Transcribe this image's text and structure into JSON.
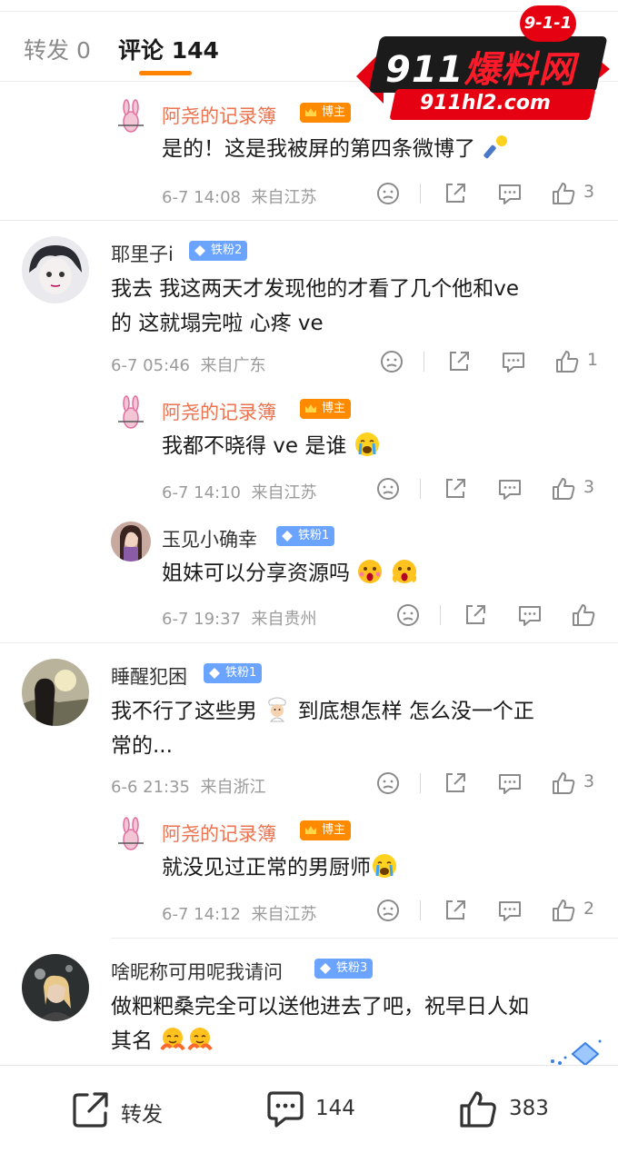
{
  "tabs": {
    "repost_label": "转发 0",
    "comments_label": "评论 144",
    "likes_partial": "3"
  },
  "watermark": {
    "badge": "9-1-1",
    "title_num": "911",
    "title_cn": "爆料网",
    "url": "911hl2.com"
  },
  "comments": [
    {
      "name": "阿尧的记录簿",
      "badge": "博主",
      "text": [
        "是的！这是我被屏的第四条微博了"
      ],
      "time": "6-7 14:08",
      "loc": "来自江苏",
      "likes": "3"
    },
    {
      "name": "耶里子i",
      "badge": "铁粉2",
      "text": [
        "我去 我这两天才发现他的才看了几个他和ve",
        "的  这就塌完啦    心疼 ve"
      ],
      "time": "6-7 05:46",
      "loc": "来自广东",
      "likes": "1"
    },
    {
      "name": "阿尧的记录簿",
      "badge": "博主",
      "text": [
        "我都不晓得 ve 是谁"
      ],
      "time": "6-7 14:10",
      "loc": "来自江苏",
      "likes": "3"
    },
    {
      "name": "玉见小确幸",
      "badge": "铁粉1",
      "text": [
        "姐妹可以分享资源吗"
      ],
      "time": "6-7 19:37",
      "loc": "来自贵州",
      "likes": ""
    },
    {
      "name": "睡醒犯困",
      "badge": "铁粉1",
      "text": [
        "我不行了这些男",
        "到底想怎样 怎么没一个正",
        "常的..."
      ],
      "time": "6-6 21:35",
      "loc": "来自浙江",
      "likes": "3"
    },
    {
      "name": "阿尧的记录簿",
      "badge": "博主",
      "text": [
        "就没见过正常的男厨师"
      ],
      "time": "6-7 14:12",
      "loc": "来自江苏",
      "likes": "2"
    },
    {
      "name": "啥昵称可用呢我请问",
      "badge": "铁粉3",
      "text": [
        "做粑粑桑完全可以送他进去了吧，祝早日人如",
        "其名"
      ],
      "time": "",
      "loc": "",
      "likes": ""
    }
  ],
  "bottom": {
    "repost": "转发",
    "comments": "144",
    "likes": "383"
  },
  "colors": {
    "accent": "#ff8200",
    "author": "#eb7350",
    "host_badge": "#ff8a00",
    "fan_badge": "#6aa4ff"
  }
}
